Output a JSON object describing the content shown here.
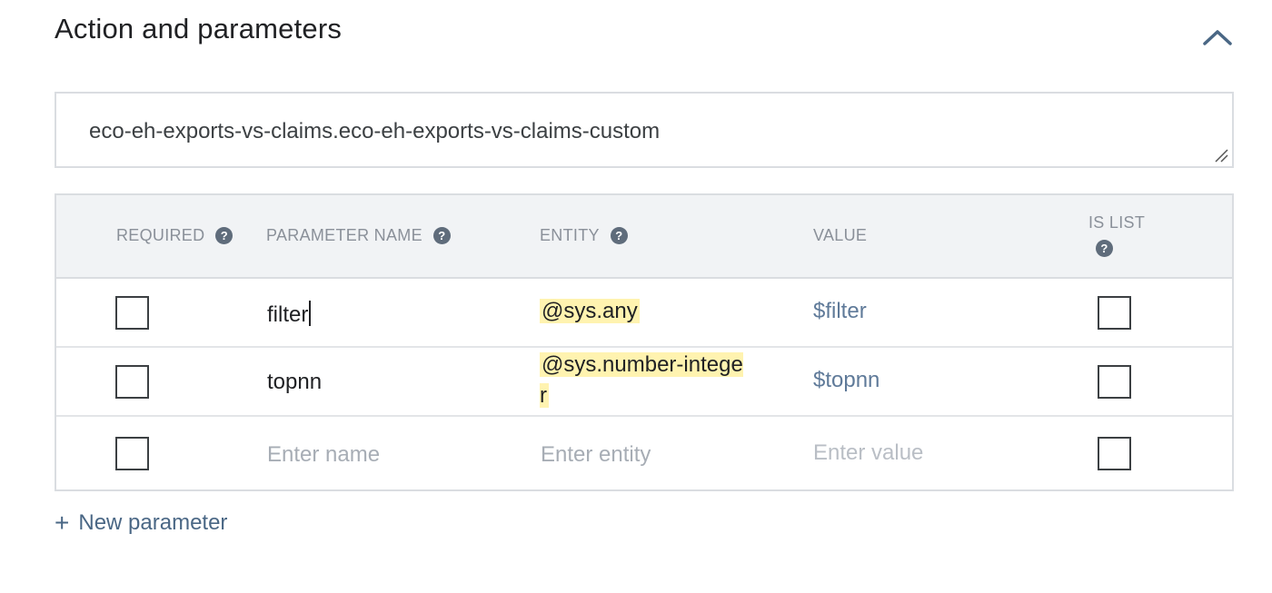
{
  "section": {
    "title": "Action and parameters"
  },
  "action": {
    "value": "eco-eh-exports-vs-claims.eco-eh-exports-vs-claims-custom"
  },
  "table": {
    "headers": {
      "required": "REQUIRED",
      "parameter_name": "PARAMETER NAME",
      "entity": "ENTITY",
      "value": "VALUE",
      "is_list": "IS LIST"
    },
    "help_glyph": "?",
    "rows": [
      {
        "required": false,
        "name": "filter",
        "entity": "@sys.any",
        "value": "$filter",
        "is_list": false
      },
      {
        "required": false,
        "name": "topnn",
        "entity": "@sys.number-integer",
        "value": "$topnn",
        "is_list": false
      }
    ],
    "empty_row": {
      "name_placeholder": "Enter name",
      "entity_placeholder": "Enter entity",
      "value_placeholder": "Enter value"
    }
  },
  "new_parameter": {
    "icon": "+",
    "label": "New parameter"
  },
  "icons": {
    "collapse": "chevron-up-icon",
    "help": "help-circle-icon",
    "resize": "resize-grip-icon"
  },
  "colors": {
    "entity_highlight": "#fff3b0",
    "value_text": "#5f7a99",
    "link": "#4a6785",
    "header_bg": "#f1f3f5"
  }
}
